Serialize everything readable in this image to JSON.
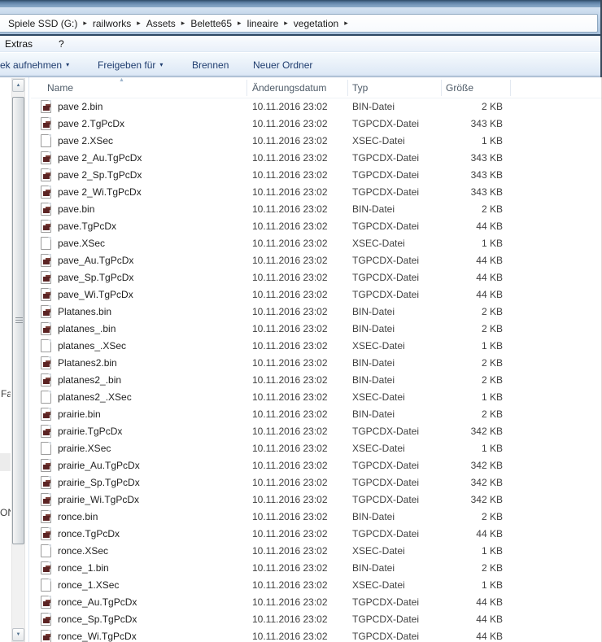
{
  "breadcrumb": {
    "separator": "▸",
    "items": [
      "Spiele SSD (G:)",
      "railworks",
      "Assets",
      "Belette65",
      "lineaire",
      "vegetation"
    ]
  },
  "menubar": {
    "items": [
      "Extras",
      "?"
    ]
  },
  "toolbar": {
    "dropdown_arrow": "▾",
    "buttons": [
      {
        "label": "ek aufnehmen",
        "dropdown": true
      },
      {
        "label": "Freigeben für",
        "dropdown": true
      },
      {
        "label": "Brennen",
        "dropdown": false
      },
      {
        "label": "Neuer Ordner",
        "dropdown": false
      }
    ]
  },
  "nav_pane": {
    "fragments": [
      "Fa",
      "ON"
    ]
  },
  "scrollbar": {
    "up_arrow": "▲",
    "down_arrow": "▼"
  },
  "list": {
    "columns": {
      "name": "Name",
      "date": "Änderungsdatum",
      "type": "Typ",
      "size": "Größe"
    },
    "sort_arrow": "▲",
    "files": [
      {
        "name": "pave 2.bin",
        "date": "10.11.2016 23:02",
        "type": "BIN-Datei",
        "size": "2 KB",
        "icon": "red-doc"
      },
      {
        "name": "pave 2.TgPcDx",
        "date": "10.11.2016 23:02",
        "type": "TGPCDX-Datei",
        "size": "343 KB",
        "icon": "red-doc"
      },
      {
        "name": "pave 2.XSec",
        "date": "10.11.2016 23:02",
        "type": "XSEC-Datei",
        "size": "1 KB",
        "icon": "blank-doc"
      },
      {
        "name": "pave 2_Au.TgPcDx",
        "date": "10.11.2016 23:02",
        "type": "TGPCDX-Datei",
        "size": "343 KB",
        "icon": "red-doc"
      },
      {
        "name": "pave 2_Sp.TgPcDx",
        "date": "10.11.2016 23:02",
        "type": "TGPCDX-Datei",
        "size": "343 KB",
        "icon": "red-doc"
      },
      {
        "name": "pave 2_Wi.TgPcDx",
        "date": "10.11.2016 23:02",
        "type": "TGPCDX-Datei",
        "size": "343 KB",
        "icon": "red-doc"
      },
      {
        "name": "pave.bin",
        "date": "10.11.2016 23:02",
        "type": "BIN-Datei",
        "size": "2 KB",
        "icon": "red-doc"
      },
      {
        "name": "pave.TgPcDx",
        "date": "10.11.2016 23:02",
        "type": "TGPCDX-Datei",
        "size": "44 KB",
        "icon": "red-doc"
      },
      {
        "name": "pave.XSec",
        "date": "10.11.2016 23:02",
        "type": "XSEC-Datei",
        "size": "1 KB",
        "icon": "blank-doc"
      },
      {
        "name": "pave_Au.TgPcDx",
        "date": "10.11.2016 23:02",
        "type": "TGPCDX-Datei",
        "size": "44 KB",
        "icon": "red-doc"
      },
      {
        "name": "pave_Sp.TgPcDx",
        "date": "10.11.2016 23:02",
        "type": "TGPCDX-Datei",
        "size": "44 KB",
        "icon": "red-doc"
      },
      {
        "name": "pave_Wi.TgPcDx",
        "date": "10.11.2016 23:02",
        "type": "TGPCDX-Datei",
        "size": "44 KB",
        "icon": "red-doc"
      },
      {
        "name": "Platanes.bin",
        "date": "10.11.2016 23:02",
        "type": "BIN-Datei",
        "size": "2 KB",
        "icon": "red-doc"
      },
      {
        "name": "platanes_.bin",
        "date": "10.11.2016 23:02",
        "type": "BIN-Datei",
        "size": "2 KB",
        "icon": "red-doc"
      },
      {
        "name": "platanes_.XSec",
        "date": "10.11.2016 23:02",
        "type": "XSEC-Datei",
        "size": "1 KB",
        "icon": "blank-doc"
      },
      {
        "name": "Platanes2.bin",
        "date": "10.11.2016 23:02",
        "type": "BIN-Datei",
        "size": "2 KB",
        "icon": "red-doc"
      },
      {
        "name": "platanes2_.bin",
        "date": "10.11.2016 23:02",
        "type": "BIN-Datei",
        "size": "2 KB",
        "icon": "red-doc"
      },
      {
        "name": "platanes2_.XSec",
        "date": "10.11.2016 23:02",
        "type": "XSEC-Datei",
        "size": "1 KB",
        "icon": "blank-doc"
      },
      {
        "name": "prairie.bin",
        "date": "10.11.2016 23:02",
        "type": "BIN-Datei",
        "size": "2 KB",
        "icon": "red-doc"
      },
      {
        "name": "prairie.TgPcDx",
        "date": "10.11.2016 23:02",
        "type": "TGPCDX-Datei",
        "size": "342 KB",
        "icon": "red-doc"
      },
      {
        "name": "prairie.XSec",
        "date": "10.11.2016 23:02",
        "type": "XSEC-Datei",
        "size": "1 KB",
        "icon": "blank-doc"
      },
      {
        "name": "prairie_Au.TgPcDx",
        "date": "10.11.2016 23:02",
        "type": "TGPCDX-Datei",
        "size": "342 KB",
        "icon": "red-doc"
      },
      {
        "name": "prairie_Sp.TgPcDx",
        "date": "10.11.2016 23:02",
        "type": "TGPCDX-Datei",
        "size": "342 KB",
        "icon": "red-doc"
      },
      {
        "name": "prairie_Wi.TgPcDx",
        "date": "10.11.2016 23:02",
        "type": "TGPCDX-Datei",
        "size": "342 KB",
        "icon": "red-doc"
      },
      {
        "name": "ronce.bin",
        "date": "10.11.2016 23:02",
        "type": "BIN-Datei",
        "size": "2 KB",
        "icon": "red-doc"
      },
      {
        "name": "ronce.TgPcDx",
        "date": "10.11.2016 23:02",
        "type": "TGPCDX-Datei",
        "size": "44 KB",
        "icon": "red-doc"
      },
      {
        "name": "ronce.XSec",
        "date": "10.11.2016 23:02",
        "type": "XSEC-Datei",
        "size": "1 KB",
        "icon": "blank-doc"
      },
      {
        "name": "ronce_1.bin",
        "date": "10.11.2016 23:02",
        "type": "BIN-Datei",
        "size": "2 KB",
        "icon": "red-doc"
      },
      {
        "name": "ronce_1.XSec",
        "date": "10.11.2016 23:02",
        "type": "XSEC-Datei",
        "size": "1 KB",
        "icon": "blank-doc"
      },
      {
        "name": "ronce_Au.TgPcDx",
        "date": "10.11.2016 23:02",
        "type": "TGPCDX-Datei",
        "size": "44 KB",
        "icon": "red-doc"
      },
      {
        "name": "ronce_Sp.TgPcDx",
        "date": "10.11.2016 23:02",
        "type": "TGPCDX-Datei",
        "size": "44 KB",
        "icon": "red-doc"
      },
      {
        "name": "ronce_Wi.TgPcDx",
        "date": "10.11.2016 23:02",
        "type": "TGPCDX-Datei",
        "size": "44 KB",
        "icon": "red-doc"
      }
    ]
  },
  "colors": {
    "accent_maroon": "#5c2424",
    "toolbar_text": "#1e3c6e",
    "header_text": "#4e5b68",
    "glass_blue": "#b7cde4"
  }
}
